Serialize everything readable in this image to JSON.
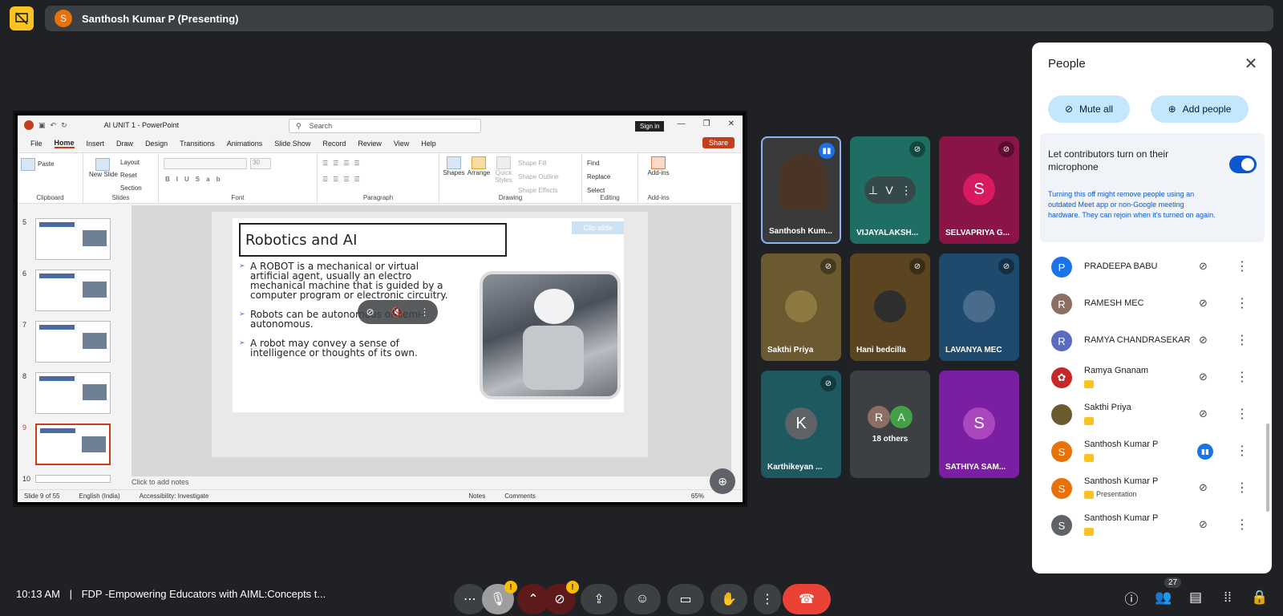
{
  "topbar": {
    "presenter_initial": "S",
    "presenter_text": "Santhosh Kumar P (Presenting)"
  },
  "ppt": {
    "window_title": "AI UNIT 1 - PowerPoint",
    "search_placeholder": "Search",
    "sign_in": "Sign in",
    "menu": [
      "File",
      "Home",
      "Insert",
      "Draw",
      "Design",
      "Transitions",
      "Animations",
      "Slide Show",
      "Record",
      "Review",
      "View",
      "Help"
    ],
    "share_label": "Share",
    "ribbon": {
      "paste": "Paste",
      "clipboard": "Clipboard",
      "new_slide": "New Slide",
      "layout": "Layout",
      "reset": "Reset",
      "section": "Section",
      "slides": "Slides",
      "font_size": "30",
      "font": "Font",
      "paragraph": "Paragraph",
      "shapes": "Shapes",
      "arrange": "Arrange",
      "quick_styles": "Quick Styles",
      "shape_fill": "Shape Fill",
      "shape_outline": "Shape Outline",
      "shape_effects": "Shape Effects",
      "drawing": "Drawing",
      "find": "Find",
      "replace": "Replace",
      "select": "Select",
      "editing": "Editing",
      "addins": "Add-ins",
      "addins_group": "Add-ins"
    },
    "thumb_numbers": [
      "5",
      "6",
      "7",
      "8",
      "9",
      "10"
    ],
    "slide": {
      "title": "Robotics and AI",
      "clip_slide": "Clip slide",
      "bullets": [
        "A ROBOT is a mechanical or virtual artificial agent, usually an electro mechanical machine that is guided by a computer program or electronic circuitry.",
        "Robots can be autonomous or semi-autonomous.",
        "A robot may convey a sense of intelligence or thoughts of its own."
      ]
    },
    "notes_placeholder": "Click to add notes",
    "status": {
      "slide": "Slide 9 of 55",
      "language": "English (India)",
      "accessibility": "Accessibility: Investigate",
      "notes": "Notes",
      "comments": "Comments",
      "zoom": "65%"
    }
  },
  "tiles": [
    {
      "name": "Santhosh Kum...",
      "initial": "",
      "color": "#3a3a3a"
    },
    {
      "name": "VIJAYALAKSH...",
      "initial": "V",
      "color": "#1f6e63"
    },
    {
      "name": "SELVAPRIYA G...",
      "initial": "S",
      "color": "#8a1448"
    },
    {
      "name": "Sakthi Priya",
      "initial": "",
      "color": "#6b5a30"
    },
    {
      "name": "Hani bedcilla",
      "initial": "",
      "color": "#5b4520"
    },
    {
      "name": "LAVANYA MEC",
      "initial": "",
      "color": "#1e4a6e"
    },
    {
      "name": "Karthikeyan ...",
      "initial": "K",
      "color": "#1e5960"
    },
    {
      "name": "18 others",
      "initial": "",
      "color": "#3c4043"
    },
    {
      "name": "SATHIYA SAM...",
      "initial": "S",
      "color": "#7b1fa2"
    }
  ],
  "others_avatars": [
    "R",
    "A"
  ],
  "people": {
    "title": "People",
    "mute_all": "Mute all",
    "add_people": "Add people",
    "host_toggle_label": "Let contributors turn on their microphone",
    "host_note": "Turning this off might remove people using an outdated Meet app or non-Google meeting hardware. They can rejoin when it's turned on again.",
    "list": [
      {
        "name": "PRADEEPA BABU",
        "initial": "P",
        "color": "#1a73e8",
        "sub": ""
      },
      {
        "name": "RAMESH MEC",
        "initial": "R",
        "color": "#8d6e63",
        "sub": ""
      },
      {
        "name": "RAMYA CHANDRASEKAR",
        "initial": "R",
        "color": "#5c6bc0",
        "sub": ""
      },
      {
        "name": "Ramya Gnanam",
        "initial": "",
        "color": "#c62828",
        "sub": ""
      },
      {
        "name": "Sakthi Priya",
        "initial": "",
        "color": "#6b5a30",
        "sub": ""
      },
      {
        "name": "Santhosh Kumar P",
        "initial": "S",
        "color": "#e8710a",
        "sub": ""
      },
      {
        "name": "Santhosh Kumar P",
        "initial": "S",
        "color": "#e8710a",
        "sub": "Presentation"
      },
      {
        "name": "Santhosh Kumar P",
        "initial": "S",
        "color": "#5f6368",
        "sub": ""
      }
    ]
  },
  "bottombar": {
    "time": "10:13 AM",
    "separator": "|",
    "meeting_title": "FDP -Empowering Educators with AIML:Concepts t...",
    "participant_count": "27",
    "warn": "!"
  }
}
